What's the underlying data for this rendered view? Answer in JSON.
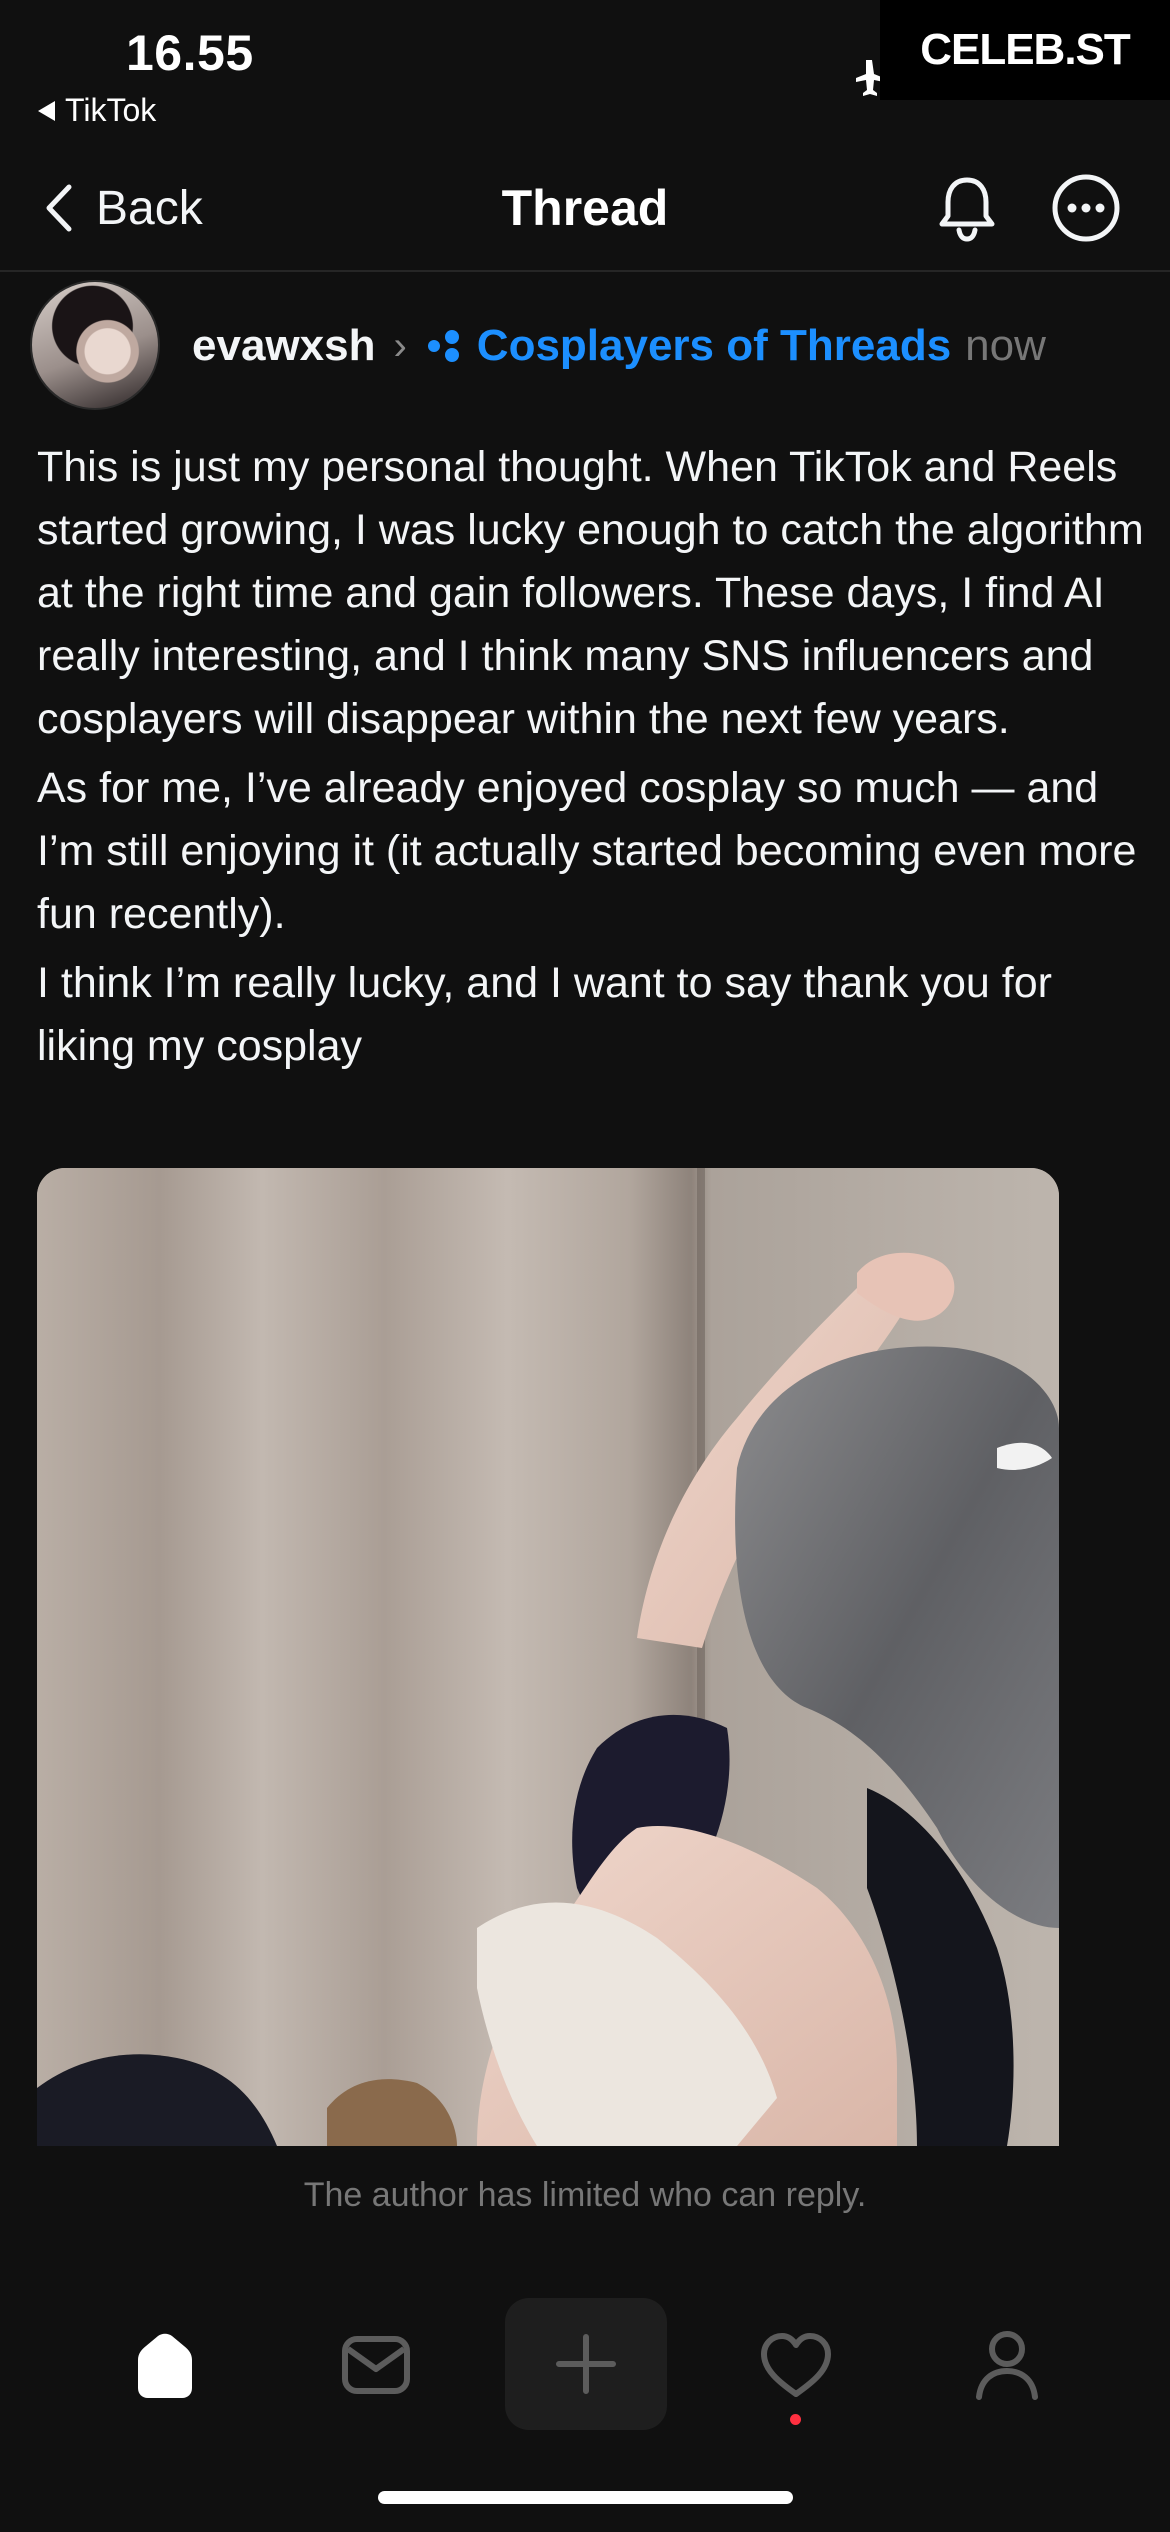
{
  "status_bar": {
    "time": "16.55",
    "back_to_app": "TikTok",
    "watermark": "CELEB.ST"
  },
  "nav": {
    "back_label": "Back",
    "title": "Thread",
    "icons": [
      "chevron-left-icon",
      "bell-icon",
      "more-icon"
    ]
  },
  "post": {
    "username": "evawxsh",
    "community": "Cosplayers of Threads",
    "time_ago": "now",
    "paragraphs": [
      "This is just my personal thought. When TikTok and Reels started growing, I was lucky enough to catch the algorithm at the right time and gain followers. These days, I find AI really interesting, and I think many SNS influencers and cosplayers will disappear within the next few years.",
      "As for me, I’ve already enjoyed cosplay so much — and I’m still enjoying it (it actually started becoming even more fun recently).",
      "I think I’m really lucky, and I want to say thank you for liking my cosplay"
    ],
    "reply_limit": "The author has limited who can reply."
  },
  "tab_bar": {
    "items": [
      "home-icon",
      "inbox-icon",
      "compose-icon",
      "heart-icon",
      "profile-icon"
    ],
    "activity_badge_color": "#ff3040"
  },
  "colors": {
    "background": "#101010",
    "accent_link": "#1c8fff",
    "muted_text": "#777777"
  }
}
